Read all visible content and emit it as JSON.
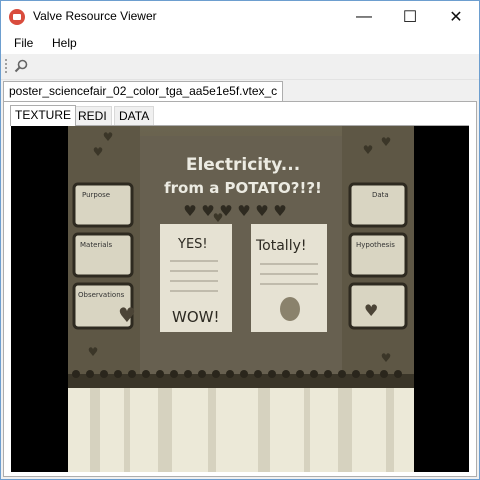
{
  "window": {
    "title": "Valve Resource Viewer",
    "icon": "app-icon",
    "controls": {
      "minimize": "—",
      "maximize": "☐",
      "close": "✕"
    }
  },
  "menu": {
    "items": [
      "File",
      "Help"
    ]
  },
  "toolbar": {
    "search_icon": "search-icon"
  },
  "document_tab": {
    "label": "poster_sciencefair_02_color_tga_aa5e1e5f.vtex_c"
  },
  "view_tabs": {
    "items": [
      "TEXTURE",
      "REDI",
      "DATA"
    ],
    "selected": "TEXTURE"
  },
  "texture": {
    "headline_line1": "Electricity...",
    "headline_line2": "from a POTATO?!?!",
    "left_cards": [
      "Purpose",
      "Materials",
      "Observations"
    ],
    "right_cards": [
      "Data",
      "Hypothesis"
    ],
    "center_note_left": "YES!",
    "center_note_left_bottom": "WOW!",
    "center_note_right": "Totally!"
  }
}
